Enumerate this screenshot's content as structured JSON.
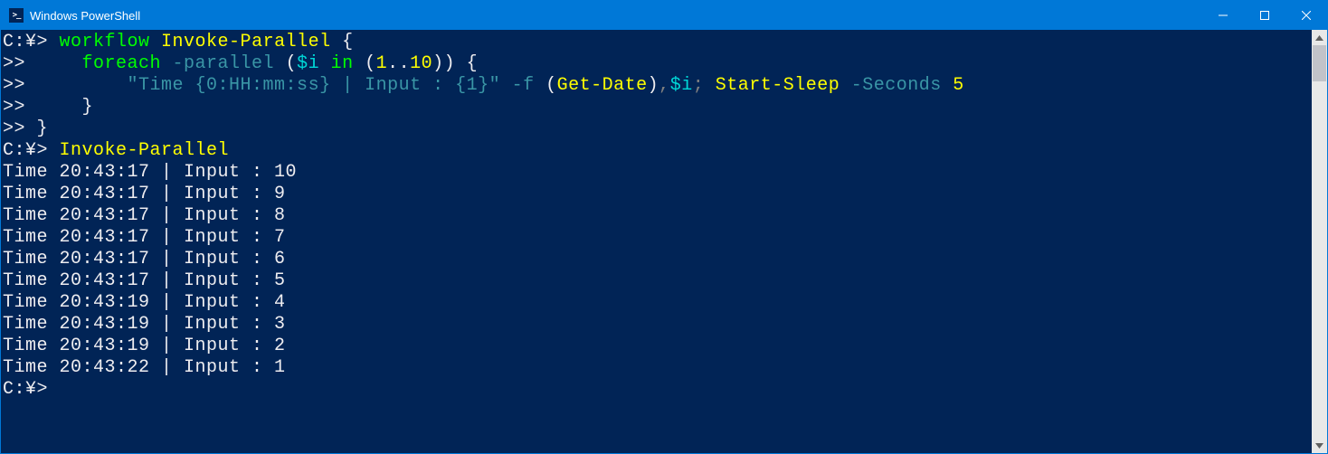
{
  "window": {
    "title": "Windows PowerShell",
    "icon_glyph": ">_"
  },
  "terminal": {
    "lines": [
      {
        "tokens": [
          {
            "t": "C:¥> ",
            "c": "c-white"
          },
          {
            "t": "workflow ",
            "c": "c-green"
          },
          {
            "t": "Invoke-Parallel ",
            "c": "c-yellow"
          },
          {
            "t": "{",
            "c": "c-white"
          }
        ]
      },
      {
        "tokens": [
          {
            "t": ">>     ",
            "c": "c-white"
          },
          {
            "t": "foreach ",
            "c": "c-green"
          },
          {
            "t": "-parallel ",
            "c": "c-darkcy"
          },
          {
            "t": "(",
            "c": "c-white"
          },
          {
            "t": "$i ",
            "c": "c-cyan"
          },
          {
            "t": "in ",
            "c": "c-green"
          },
          {
            "t": "(",
            "c": "c-white"
          },
          {
            "t": "1",
            "c": "c-yellow"
          },
          {
            "t": "..",
            "c": "c-white"
          },
          {
            "t": "10",
            "c": "c-yellow"
          },
          {
            "t": ")) {",
            "c": "c-white"
          }
        ]
      },
      {
        "tokens": [
          {
            "t": ">>         ",
            "c": "c-white"
          },
          {
            "t": "\"Time {0:HH:mm:ss} | Input : {1}\" ",
            "c": "c-darkcy"
          },
          {
            "t": "-f ",
            "c": "c-darkcy"
          },
          {
            "t": "(",
            "c": "c-white"
          },
          {
            "t": "Get-Date",
            "c": "c-yellow"
          },
          {
            "t": ")",
            "c": "c-white"
          },
          {
            "t": ",",
            "c": "c-gray"
          },
          {
            "t": "$i",
            "c": "c-cyan"
          },
          {
            "t": "; ",
            "c": "c-gray"
          },
          {
            "t": "Start-Sleep ",
            "c": "c-yellow"
          },
          {
            "t": "-Seconds ",
            "c": "c-darkcy"
          },
          {
            "t": "5",
            "c": "c-yellow"
          }
        ]
      },
      {
        "tokens": [
          {
            "t": ">>     }",
            "c": "c-white"
          }
        ]
      },
      {
        "tokens": [
          {
            "t": ">> }",
            "c": "c-white"
          }
        ]
      },
      {
        "tokens": [
          {
            "t": "C:¥> ",
            "c": "c-white"
          },
          {
            "t": "Invoke-Parallel",
            "c": "c-yellow"
          }
        ]
      },
      {
        "tokens": [
          {
            "t": "Time 20:43:17 | Input : 10",
            "c": "c-white"
          }
        ]
      },
      {
        "tokens": [
          {
            "t": "Time 20:43:17 | Input : 9",
            "c": "c-white"
          }
        ]
      },
      {
        "tokens": [
          {
            "t": "Time 20:43:17 | Input : 8",
            "c": "c-white"
          }
        ]
      },
      {
        "tokens": [
          {
            "t": "Time 20:43:17 | Input : 7",
            "c": "c-white"
          }
        ]
      },
      {
        "tokens": [
          {
            "t": "Time 20:43:17 | Input : 6",
            "c": "c-white"
          }
        ]
      },
      {
        "tokens": [
          {
            "t": "Time 20:43:17 | Input : 5",
            "c": "c-white"
          }
        ]
      },
      {
        "tokens": [
          {
            "t": "Time 20:43:19 | Input : 4",
            "c": "c-white"
          }
        ]
      },
      {
        "tokens": [
          {
            "t": "Time 20:43:19 | Input : 3",
            "c": "c-white"
          }
        ]
      },
      {
        "tokens": [
          {
            "t": "Time 20:43:19 | Input : 2",
            "c": "c-white"
          }
        ]
      },
      {
        "tokens": [
          {
            "t": "Time 20:43:22 | Input : 1",
            "c": "c-white"
          }
        ]
      },
      {
        "tokens": [
          {
            "t": "C:¥>",
            "c": "c-white"
          }
        ]
      }
    ]
  }
}
